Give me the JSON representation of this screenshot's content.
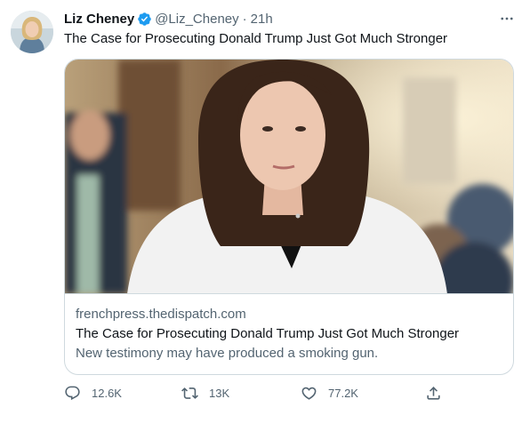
{
  "tweet": {
    "author_name": "Liz Cheney",
    "handle": "@Liz_Cheney",
    "separator": "·",
    "time": "21h",
    "text": "The Case for Prosecuting Donald Trump Just Got Much Stronger",
    "verified_color": "#1d9bf0"
  },
  "card": {
    "domain": "frenchpress.thedispatch.com",
    "title": "The Case for Prosecuting Donald Trump Just Got Much Stronger",
    "description": "New testimony may have produced a smoking gun."
  },
  "actions": {
    "reply_count": "12.6K",
    "retweet_count": "13K",
    "like_count": "77.2K"
  },
  "icons": {
    "reply": "reply-icon",
    "retweet": "retweet-icon",
    "like": "heart-icon",
    "share": "share-icon",
    "more": "more-icon",
    "verified": "verified-badge-icon"
  },
  "colors": {
    "text_primary": "#0f1419",
    "text_secondary": "#536471",
    "border": "#cfd9de"
  }
}
